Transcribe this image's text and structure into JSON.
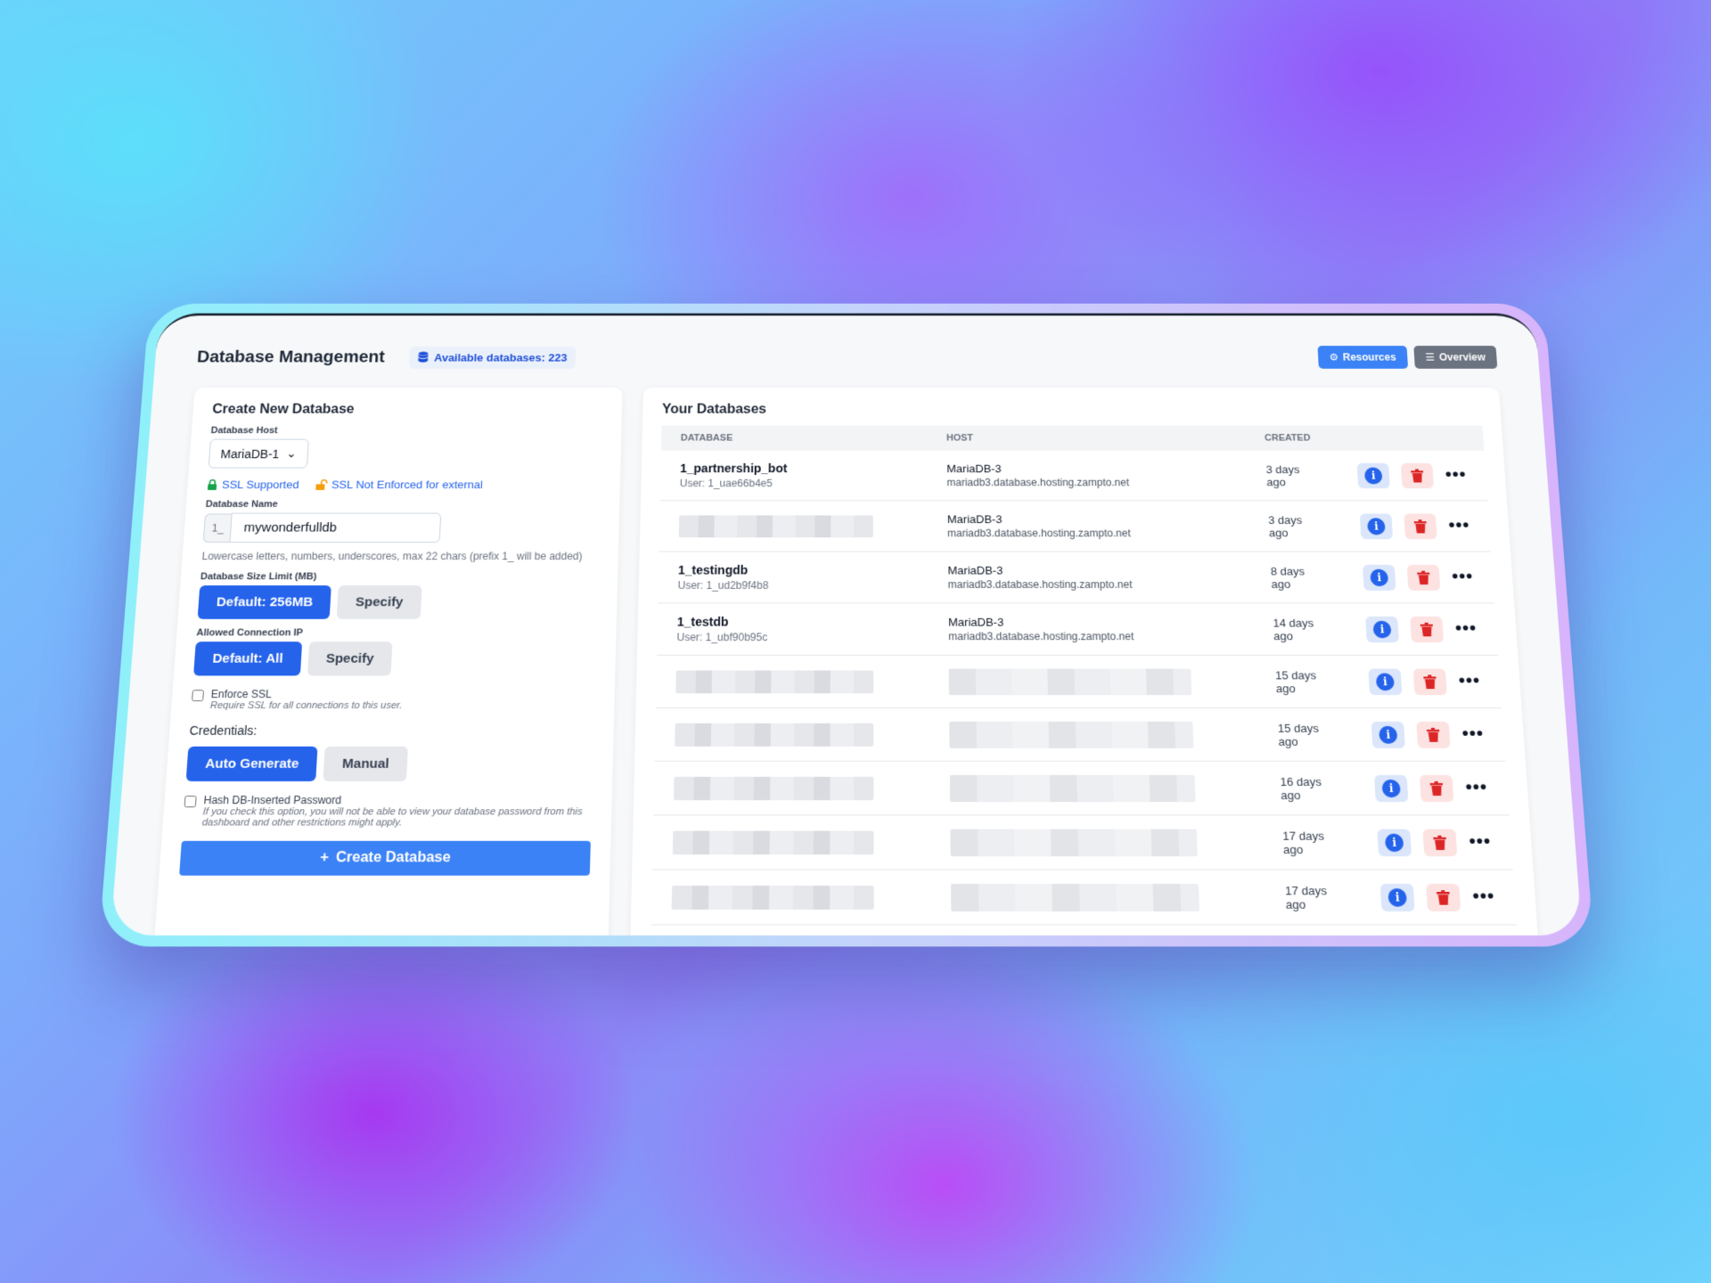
{
  "header": {
    "title": "Database Management",
    "available": "Available databases: 223",
    "resources_label": "Resources",
    "overview_label": "Overview"
  },
  "create": {
    "heading": "Create New Database",
    "host_label": "Database Host",
    "host_value": "MariaDB-1",
    "ssl_supported": "SSL Supported",
    "ssl_not_enforced": "SSL Not Enforced for external",
    "name_label": "Database Name",
    "name_prefix": "1_",
    "name_value": "mywonderfulldb",
    "name_hint": "Lowercase letters, numbers, underscores, max 22 chars (prefix 1_ will be added)",
    "size_label": "Database Size Limit (MB)",
    "size_default": "Default: 256MB",
    "size_specify": "Specify",
    "ip_label": "Allowed Connection IP",
    "ip_default": "Default: All",
    "ip_specify": "Specify",
    "enforce_ssl": "Enforce SSL",
    "enforce_ssl_hint": "Require SSL for all connections to this user.",
    "credentials": "Credentials:",
    "auto_generate": "Auto Generate",
    "manual": "Manual",
    "hash_label": "Hash DB-Inserted Password",
    "hash_hint": "If you check this option, you will not be able to view your database password from this dashboard and other restrictions might apply.",
    "create_button": "Create Database"
  },
  "list": {
    "heading": "Your Databases",
    "columns": [
      "DATABASE",
      "HOST",
      "CREATED"
    ],
    "rows": [
      {
        "name": "1_partnership_bot",
        "user": "User: 1_uae66b4e5",
        "host": "MariaDB-3",
        "domain": "mariadb3.database.hosting.zampto.net",
        "created": "3 days ago"
      },
      {
        "name": "",
        "user": "",
        "host": "MariaDB-3",
        "domain": "mariadb3.database.hosting.zampto.net",
        "created": "3 days ago"
      },
      {
        "name": "1_testingdb",
        "user": "User: 1_ud2b9f4b8",
        "host": "MariaDB-3",
        "domain": "mariadb3.database.hosting.zampto.net",
        "created": "8 days ago"
      },
      {
        "name": "1_testdb",
        "user": "User: 1_ubf90b95c",
        "host": "MariaDB-3",
        "domain": "mariadb3.database.hosting.zampto.net",
        "created": "14 days ago"
      },
      {
        "name": "",
        "user": "",
        "host": "",
        "domain": "",
        "created": "15 days ago"
      },
      {
        "name": "",
        "user": "",
        "host": "",
        "domain": "",
        "created": "15 days ago"
      },
      {
        "name": "",
        "user": "",
        "host": "",
        "domain": "",
        "created": "16 days ago"
      },
      {
        "name": "",
        "user": "",
        "host": "",
        "domain": "",
        "created": "17 days ago"
      },
      {
        "name": "",
        "user": "",
        "host": "",
        "domain": "",
        "created": "17 days ago"
      }
    ]
  },
  "colors": {
    "primary": "#2563eb",
    "danger": "#dc2626",
    "secondary": "#6b7280"
  },
  "icons": [
    "database-icon",
    "cogs-icon",
    "list-icon",
    "lock-icon",
    "unlock-icon",
    "plus-icon",
    "info-icon",
    "trash-icon",
    "ellipsis-icon"
  ]
}
